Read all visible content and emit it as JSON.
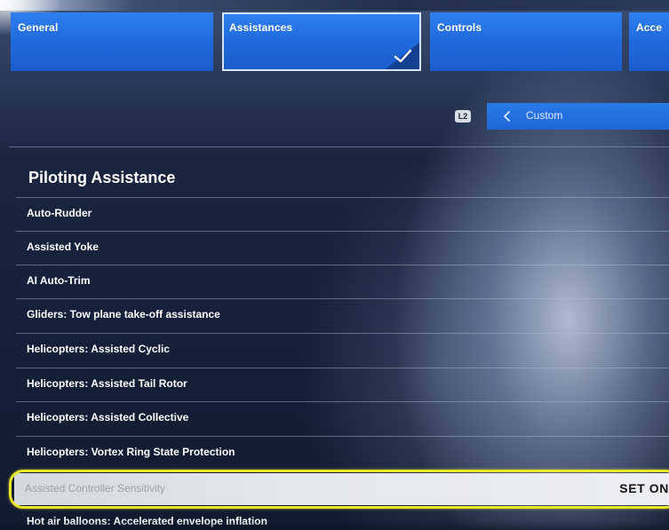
{
  "tabs": [
    {
      "label": "General",
      "selected": false
    },
    {
      "label": "Assistances",
      "selected": true
    },
    {
      "label": "Controls",
      "selected": false
    },
    {
      "label": "Acce",
      "selected": false
    }
  ],
  "preset": {
    "button_hint": "L2",
    "icon": "chevron-left-icon",
    "value": "Custom"
  },
  "section": {
    "title": "Piloting Assistance"
  },
  "options": [
    {
      "label": "Auto-Rudder"
    },
    {
      "label": "Assisted Yoke"
    },
    {
      "label": "AI Auto-Trim"
    },
    {
      "label": "Gliders: Tow plane take-off assistance"
    },
    {
      "label": "Helicopters: Assisted Cyclic"
    },
    {
      "label": "Helicopters: Assisted Tail Rotor"
    },
    {
      "label": "Helicopters: Assisted Collective"
    },
    {
      "label": "Helicopters: Vortex Ring State Protection"
    },
    {
      "label": "Assisted Controller Sensitivity",
      "value": "SET ON",
      "highlighted": true
    },
    {
      "label": "Hot air balloons: Accelerated envelope inflation"
    }
  ],
  "colors": {
    "tab_blue": "#1f68dc",
    "highlight_outline": "#e9e626",
    "row_highlight": "#e4e7ec"
  }
}
